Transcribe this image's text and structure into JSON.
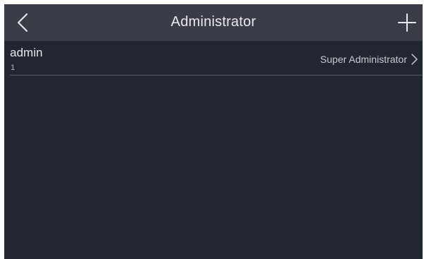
{
  "header": {
    "title": "Administrator",
    "back_icon": "chevron-left-icon",
    "add_icon": "plus-icon"
  },
  "list": {
    "items": [
      {
        "name": "admin",
        "id": "1",
        "role": "Super Administrator",
        "chevron_icon": "chevron-right-icon"
      }
    ]
  },
  "colors": {
    "background": "#222630",
    "header": "#3a3d47",
    "text": "#e6e6ea",
    "divider": "#5a5e69"
  }
}
